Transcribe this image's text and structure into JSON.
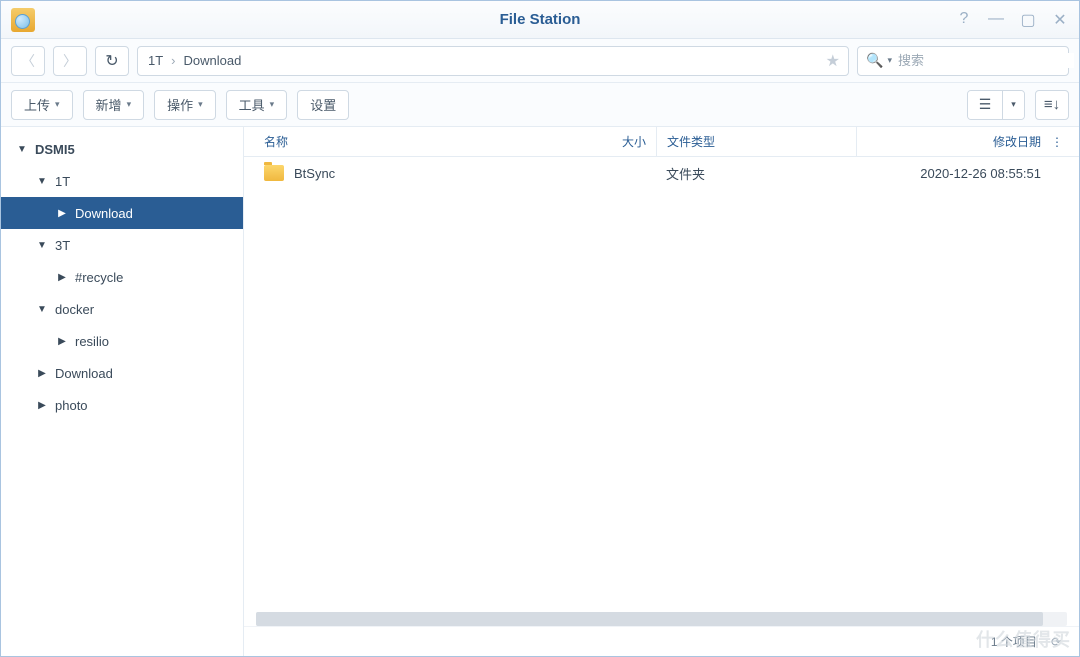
{
  "title": "File Station",
  "breadcrumb": [
    "1T",
    "Download"
  ],
  "search": {
    "placeholder": "搜索"
  },
  "toolbar": {
    "upload": "上传",
    "create": "新增",
    "action": "操作",
    "tools": "工具",
    "settings": "设置"
  },
  "tree": {
    "root": "DSMI5",
    "items": [
      {
        "label": "1T",
        "depth": 1,
        "expanded": true
      },
      {
        "label": "Download",
        "depth": 2,
        "expanded": false,
        "selected": true
      },
      {
        "label": "3T",
        "depth": 1,
        "expanded": true
      },
      {
        "label": "#recycle",
        "depth": 2,
        "expanded": false
      },
      {
        "label": "docker",
        "depth": 1,
        "expanded": true
      },
      {
        "label": "resilio",
        "depth": 2,
        "expanded": false
      },
      {
        "label": "Download",
        "depth": 1,
        "expanded": false
      },
      {
        "label": "photo",
        "depth": 1,
        "expanded": false
      }
    ]
  },
  "columns": {
    "name": "名称",
    "size": "大小",
    "type": "文件类型",
    "date": "修改日期"
  },
  "files": [
    {
      "name": "BtSync",
      "size": "",
      "type": "文件夹",
      "date": "2020-12-26 08:55:51"
    }
  ],
  "status": {
    "count": "1 个项目"
  },
  "watermark": "什么值得买"
}
